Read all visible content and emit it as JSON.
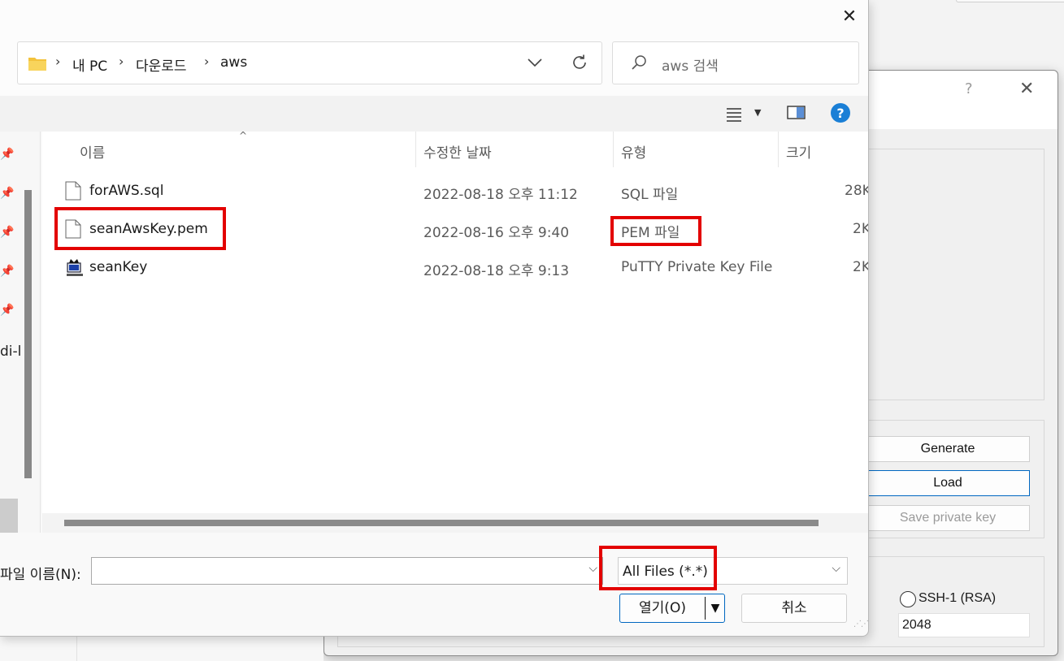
{
  "dialog": {
    "close_glyph": "✕",
    "breadcrumb": [
      "내 PC",
      "다운로드",
      "aws"
    ],
    "search_placeholder": "aws 검색",
    "columns": {
      "name": "이름",
      "modified": "수정한 날짜",
      "type": "유형",
      "size": "크기"
    },
    "files": [
      {
        "name": "forAWS.sql",
        "modified": "2022-08-18 오후 11:12",
        "type": "SQL 파일",
        "size": "28K",
        "icon": "document-icon"
      },
      {
        "name": "seanAwsKey.pem",
        "modified": "2022-08-16 오후 9:40",
        "type": "PEM 파일",
        "size": "2K",
        "icon": "document-icon"
      },
      {
        "name": "seanKey",
        "modified": "2022-08-18 오후 9:13",
        "type": "PuTTY Private Key File",
        "size": "2K",
        "icon": "putty-key-icon"
      }
    ],
    "nav_partial_text": "di-l",
    "filename_label": "파일 이름(N):",
    "filename_value": "",
    "filter_value": "All Files (*.*)",
    "open_label": "열기(O)",
    "cancel_label": "취소"
  },
  "putty": {
    "help_glyph": "?",
    "close_glyph": "✕",
    "generate_label": "Generate",
    "load_label": "Load",
    "save_private_label": "Save private key",
    "ssh1_label": "SSH-1 (RSA)",
    "bits_value": "2048"
  },
  "colors": {
    "highlight": "#e30000",
    "accent": "#0067c0",
    "help_blue": "#1a7fd6"
  }
}
